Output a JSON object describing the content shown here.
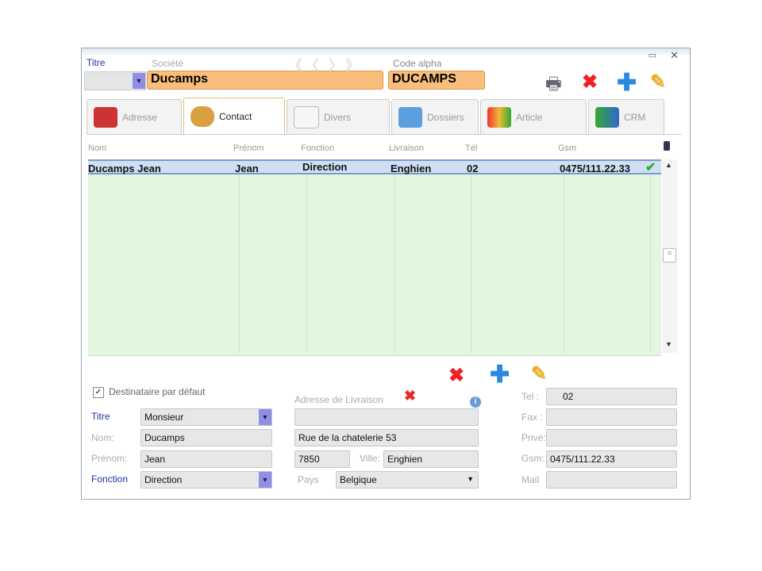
{
  "header": {
    "titre_label": "Titre",
    "societe_label": "Société",
    "societe_value": "Ducamps",
    "code_alpha_label": "Code alpha",
    "code_alpha_value": "DUCAMPS",
    "nav": [
      "《",
      "〈",
      "〉",
      "》"
    ]
  },
  "tabs": [
    {
      "label": "Adresse"
    },
    {
      "label": "Contact"
    },
    {
      "label": "Divers"
    },
    {
      "label": "Dossiers"
    },
    {
      "label": "Article"
    },
    {
      "label": "CRM"
    }
  ],
  "grid": {
    "columns": [
      "Nom",
      "Prénom",
      "Fonction",
      "Livraison",
      "Tél",
      "Gsm"
    ],
    "rows": [
      [
        "Ducamps Jean",
        "Jean",
        "Direction",
        "Enghien",
        "02",
        "0475/111.22.33"
      ]
    ]
  },
  "form": {
    "default_recipient_label": "Destinataire par défaut",
    "default_recipient_checked": true,
    "titre_label": "Titre",
    "titre_value": "Monsieur",
    "nom_label": "Nom:",
    "nom_value": "Ducamps",
    "prenom_label": "Prénom:",
    "prenom_value": "Jean",
    "fonction_label": "Fonction",
    "fonction_value": "Direction",
    "adresse_label": "Adresse de Livraison",
    "adresse_line1": "",
    "adresse_line2": "Rue de la chatelerie 53",
    "cp_value": "7850",
    "ville_label": "Ville:",
    "ville_value": "Enghien",
    "pays_label": "Pays",
    "pays_value": "Belgique",
    "tel_label": "Tel :",
    "tel_value": "02",
    "fax_label": "Fax :",
    "fax_value": "",
    "prive_label": "Privé:",
    "prive_value": "",
    "gsm_label": "Gsm:",
    "gsm_value": "0475/111.22.33",
    "mail_label": "Mail",
    "mail_value": ""
  },
  "colors": {
    "accent_orange": "#f9bd7c",
    "grid_green": "#e3f7e0",
    "selected": "#cfe0f5"
  }
}
